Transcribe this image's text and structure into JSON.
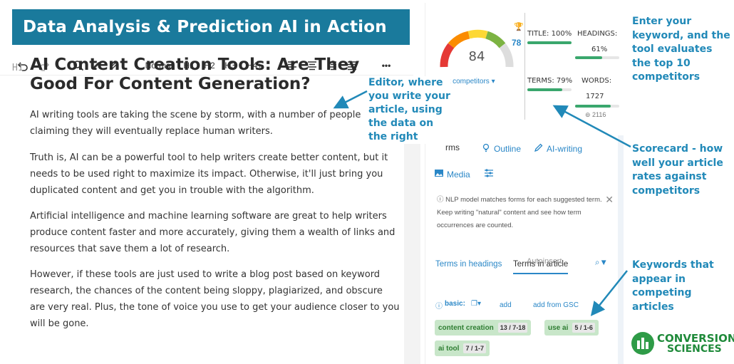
{
  "banner": {
    "title": "Data Analysis & Prediction AI in Action"
  },
  "toolbar": {
    "normal": "Normal",
    "h1": "H1",
    "h2": "H2",
    "h3": "H3",
    "h4": "H4+",
    "more": "•••"
  },
  "editor": {
    "h1_tag": "H1",
    "title": "AI Content Creation Tools: Are They Good For Content Generation?",
    "paragraphs": [
      "AI writing tools are taking the scene by storm, with a number of people claiming they will eventually replace human writers.",
      "Truth is, AI can be a powerful tool to help writers create better content, but it needs to be used right to maximize its impact. Otherwise, it'll just bring you duplicated content and get you in trouble with the algorithm.",
      "Artificial intelligence and machine learning software are great to help writers produce content faster and more accurately, giving them a wealth of links and resources that save them a lot of research.",
      "However, if these tools are just used to write a blog post based on keyword research, the chances of the content being sloppy, plagiarized, and obscure are very real. Plus, the tone of voice you use to get your audience closer to you will be gone."
    ]
  },
  "scorecard": {
    "score": "84",
    "competitor_score": "78",
    "select_competitors": "ect competitors ▾",
    "title_label": "TITLE: 100%",
    "title_pct": 1.0,
    "headings_label": "HEADINGS:",
    "headings_val": "61%",
    "headings_pct": 0.61,
    "terms_label": "TERMS: 79%",
    "terms_pct": 0.79,
    "words_label": "WORDS:",
    "words_val": "1727",
    "words_pct": 0.8,
    "gsc": "2116",
    "colors": {
      "bar": "#3aa76d",
      "accent": "#2a87c7"
    }
  },
  "panel_tabs": {
    "terms": "rms",
    "outline": "Outline",
    "ai_writing": "AI-writing",
    "media": "Media"
  },
  "info": {
    "text": "NLP model matches forms for each suggested term. Keep writing \"natural\" content and see how term occurrences are counted."
  },
  "terms_tabs": {
    "headings": "Terms in headings",
    "article": "Terms in article",
    "autoinsert": "Autoinsert"
  },
  "basic": {
    "label": "basic:",
    "add": "add",
    "add_gsc": "add from GSC"
  },
  "chips": [
    {
      "term": "content creation",
      "count": "13 / 7-18"
    },
    {
      "term": "use ai",
      "count": "5 / 1-6"
    },
    {
      "term": "ai tool",
      "count": "7 / 1-7"
    }
  ],
  "annotations": {
    "editor": "Editor, where you write your article, using the data on the right",
    "keyword": "Enter your keyword, and the tool evaluates the top 10 competitors",
    "scorecard": "Scorecard - how well your article rates against competitors",
    "keywords": "Keywords that appear in competing articles"
  },
  "logo": {
    "line1": "CONVERSION",
    "line2": "SCIENCES"
  }
}
